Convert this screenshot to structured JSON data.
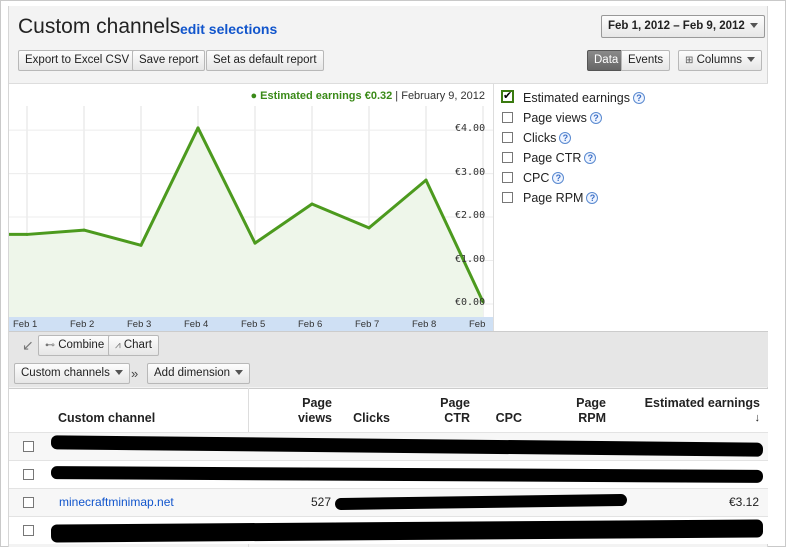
{
  "header": {
    "title": "Custom channels",
    "edit_link": "edit selections",
    "date_range": "Feb 1, 2012 – Feb 9, 2012"
  },
  "toolbar": {
    "export_label": "Export to Excel CSV",
    "save_label": "Save report",
    "default_label": "Set as default report",
    "data_tab": "Data",
    "events_tab": "Events",
    "columns_label": "Columns"
  },
  "chart_legend": {
    "metric": "Estimated earnings",
    "value": "€0.32",
    "date": "February 9, 2012"
  },
  "chart_data": {
    "type": "area",
    "categories": [
      "Feb 1",
      "Feb 2",
      "Feb 3",
      "Feb 4",
      "Feb 5",
      "Feb 6",
      "Feb 7",
      "Feb 8",
      "Feb"
    ],
    "values": [
      1.6,
      1.7,
      1.35,
      4.05,
      1.4,
      2.3,
      1.75,
      2.85,
      0.05
    ],
    "y_ticks": [
      "€0.00",
      "€1.00",
      "€2.00",
      "€3.00",
      "€4.00"
    ],
    "ylim": [
      0,
      4.6
    ],
    "line_color": "#4c9a1e",
    "fill_color": "#eef6ea"
  },
  "metrics": [
    {
      "label": "Estimated earnings",
      "checked": true
    },
    {
      "label": "Page views",
      "checked": false
    },
    {
      "label": "Clicks",
      "checked": false
    },
    {
      "label": "Page CTR",
      "checked": false
    },
    {
      "label": "CPC",
      "checked": false
    },
    {
      "label": "Page RPM",
      "checked": false
    }
  ],
  "controls": {
    "combine_label": "Combine",
    "chart_label": "Chart",
    "dimension_label": "Custom channels",
    "separator": "»",
    "add_dimension_label": "Add dimension"
  },
  "table": {
    "columns": {
      "channel": "Custom channel",
      "page": "Page",
      "views": "views",
      "clicks": "Clicks",
      "page2": "Page",
      "ctr": "CTR",
      "cpc": "CPC",
      "page3": "Page",
      "rpm": "RPM",
      "earnings": "Estimated earnings",
      "sort_arrow": "↓"
    },
    "rows": [
      {
        "channel": "",
        "views": "",
        "earnings": ""
      },
      {
        "channel": "",
        "views": "",
        "earnings": ""
      },
      {
        "channel": "minecraftminimap.net",
        "views": "527",
        "earnings": "€3.12"
      },
      {
        "channel": "",
        "views": "",
        "earnings": ""
      }
    ]
  }
}
